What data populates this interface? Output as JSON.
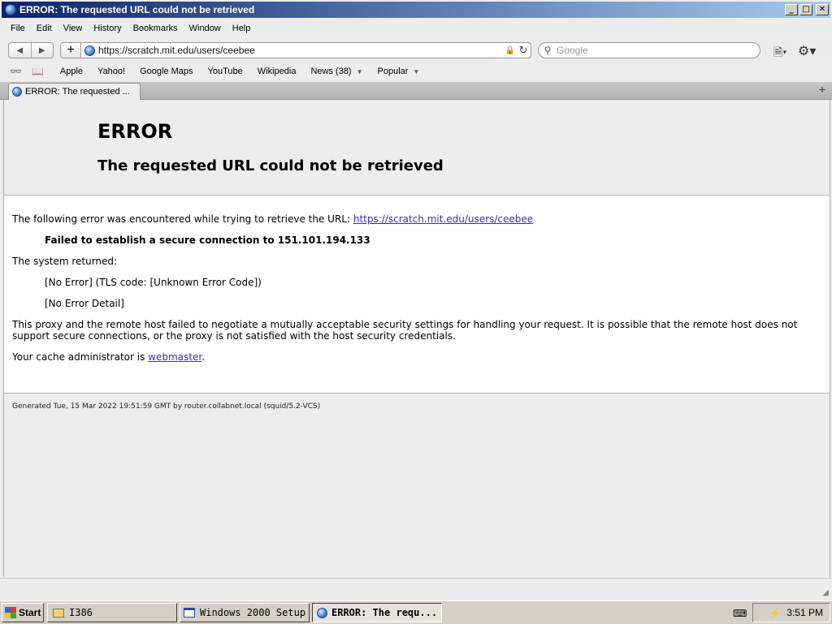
{
  "window": {
    "title": "ERROR: The requested URL could not be retrieved",
    "controls": {
      "minimize": "_",
      "maximize": "□",
      "close": "✕"
    }
  },
  "menubar": [
    "File",
    "Edit",
    "View",
    "History",
    "Bookmarks",
    "Window",
    "Help"
  ],
  "toolbar": {
    "back": "◀",
    "forward": "▶",
    "add": "+",
    "url": "https://scratch.mit.edu/users/ceebee",
    "lock": "🔒",
    "reload": "↻",
    "search_icon": "⚲",
    "search_placeholder": "Google",
    "page_menu": "🗎▾",
    "gear_menu": "⚙▾"
  },
  "bookmarks": {
    "reading_list_icon": "👓",
    "bookmarks_icon": "📖",
    "items": [
      "Apple",
      "Yahoo!",
      "Google Maps",
      "YouTube",
      "Wikipedia",
      "News (38)",
      "Popular"
    ],
    "arrow": "▼"
  },
  "tabs": [
    {
      "title": "ERROR: The requested ..."
    }
  ],
  "new_tab": "+",
  "page": {
    "heading": "ERROR",
    "subheading": "The requested URL could not be retrieved",
    "line1_prefix": "The following error was encountered while trying to retrieve the URL: ",
    "line1_link": "https://scratch.mit.edu/users/ceebee",
    "bold_line": "Failed to establish a secure connection to 151.101.194.133",
    "system_returned": "The system returned:",
    "no_error": "[No Error] (TLS code: [Unknown Error Code])",
    "no_error_detail": "[No Error Detail]",
    "explanation": "This proxy and the remote host failed to negotiate a mutually acceptable security settings for handling your request. It is possible that the remote host does not support secure connections, or the proxy is not satisfied with the host security credentials.",
    "admin_prefix": "Your cache administrator is ",
    "admin_link": "webmaster",
    "admin_suffix": ".",
    "generated": "Generated Tue, 15 Mar 2022 19:51:59 GMT by router.collabnet.local (squid/5.2-VCS)"
  },
  "statusbar": {
    "grip": "◢"
  },
  "taskbar": {
    "start": "Start",
    "buttons": [
      "I386",
      "Windows 2000 Setup",
      "ERROR: The requ..."
    ],
    "clock": "3:51 PM",
    "keyboard_icon": "⌨",
    "tray_icon": "⚡"
  }
}
